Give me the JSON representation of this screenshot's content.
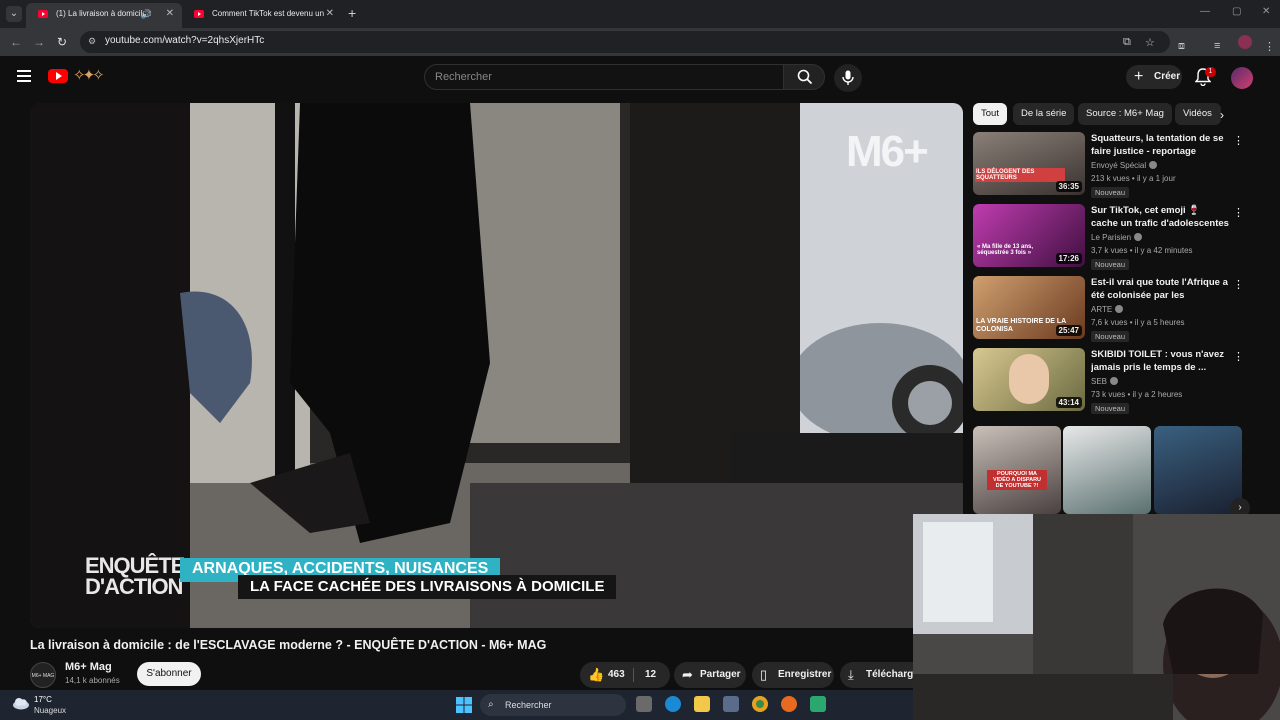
{
  "browser": {
    "tabs": [
      {
        "title": "(1) La livraison à domicile :",
        "active": true
      },
      {
        "title": "Comment TikTok est devenu un",
        "active": false
      }
    ],
    "url": "youtube.com/watch?v=2qhsXjerHTc"
  },
  "header": {
    "search_placeholder": "Rechercher",
    "create_label": "Créer",
    "notif_count": "1"
  },
  "player": {
    "channel_logo": "M6+",
    "show_logo": "ENQUÊTE D'ACTION",
    "banner_top": "ARNAQUES, ACCIDENTS, NUISANCES",
    "banner_bottom": "LA FACE CACHÉE DES LIVRAISONS À DOMICILE"
  },
  "video": {
    "title": "La livraison à domicile : de l'ESCLAVAGE moderne ? - ENQUÊTE D'ACTION - M6+ MAG",
    "channel": "M6+ Mag",
    "subscribers": "14,1 k abonnés",
    "subscribe_label": "S'abonner",
    "likes": "463",
    "comments": "12",
    "share_label": "Partager",
    "save_label": "Enregistrer",
    "download_label": "Télécharger",
    "channel_avatar_text": "M6+ MAG"
  },
  "sidebar": {
    "chips": [
      "Tout",
      "De la série",
      "Source : M6+ Mag",
      "Vidéos"
    ],
    "recommendations": [
      {
        "title": "Squatteurs, la tentation de se faire justice - reportage intégral",
        "channel": "Envoyé Spécial",
        "meta": "213 k vues • il y a 1 jour",
        "duration": "36:35",
        "badge": "Nouveau",
        "thumb_text": "ILS DÉLOGENT DES SQUATTEURS"
      },
      {
        "title": "Sur TikTok, cet emoji 🍷 cache un trafic d'adolescentes",
        "channel": "Le Parisien",
        "meta": "3,7 k vues • il y a 42 minutes",
        "duration": "17:26",
        "badge": "Nouveau",
        "thumb_text": "« Ma fille de 13 ans, séquestrée 3 fois »"
      },
      {
        "title": "Est-il vrai que toute l'Afrique a été colonisée par les Européen...",
        "channel": "ARTE",
        "meta": "7,6 k vues • il y a 5 heures",
        "duration": "25:47",
        "badge": "Nouveau",
        "thumb_text": "LA VRAIE HISTOIRE DE LA COLONISA"
      },
      {
        "title": "SKIBIDI TOILET : vous n'avez jamais pris le temps de ...",
        "channel": "SEB",
        "meta": "73 k vues • il y a 2 heures",
        "duration": "43:14",
        "badge": "Nouveau",
        "thumb_text": ""
      }
    ],
    "shorts_caption": "POURQUOI MA VIDÉO A DISPARU DE YOUTUBE ?!"
  },
  "taskbar": {
    "temperature": "17°C",
    "weather": "Nuageux",
    "search_label": "Rechercher"
  }
}
